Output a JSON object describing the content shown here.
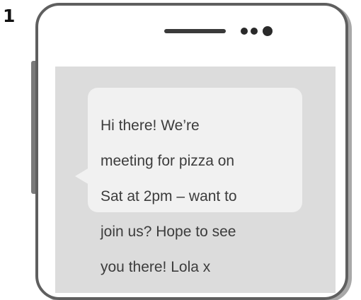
{
  "item_number": "1",
  "message": {
    "text_lines": [
      "Hi there! We’re",
      "meeting for pizza on",
      "Sat at 2pm – want to",
      "join us? Hope to see",
      "you there! Lola x"
    ]
  },
  "colors": {
    "phone_outline": "#5f5f5f",
    "screen_background": "#dcdcdc",
    "bubble_background": "#f1f1f1",
    "text": "#3c3c3c"
  },
  "icons": [
    "speaker-icon",
    "camera-icon",
    "side-button"
  ]
}
